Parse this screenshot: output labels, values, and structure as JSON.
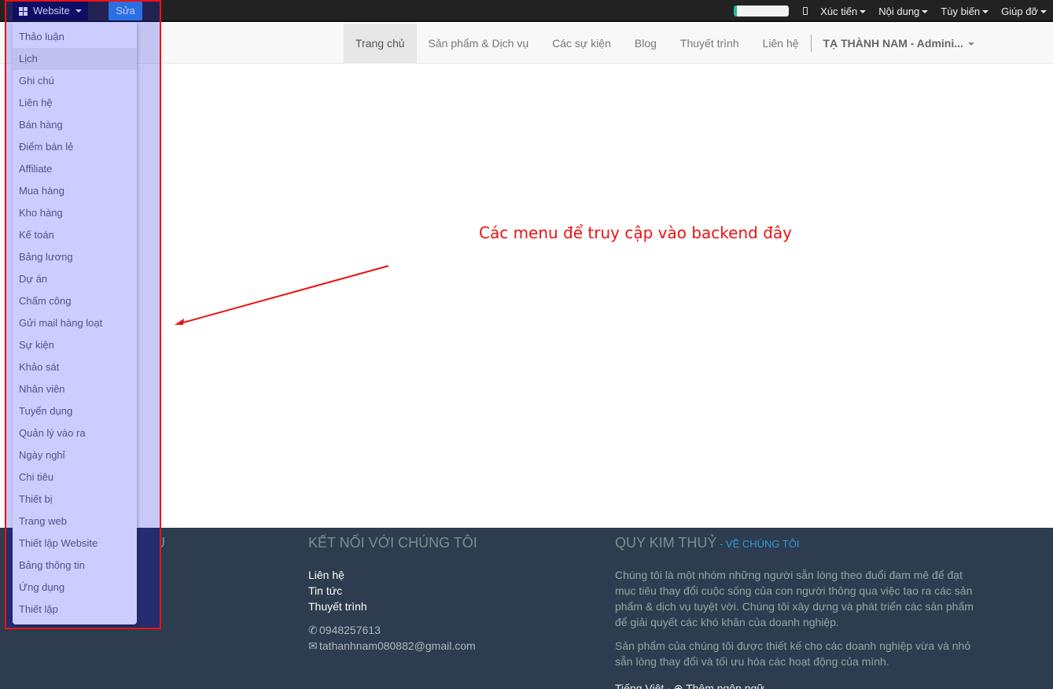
{
  "topbar": {
    "website_label": "Website",
    "edit_label": "Sửa",
    "progress_percent": 5,
    "menus": [
      "Xúc tiến",
      "Nội dung",
      "Tùy biến",
      "Giúp đỡ"
    ]
  },
  "nav": {
    "items": [
      "Trang chủ",
      "Sản phẩm & Dịch vụ",
      "Các sự kiện",
      "Blog",
      "Thuyết trình",
      "Liên hệ"
    ],
    "active_index": 0,
    "user": "TẠ THÀNH NAM - Admini..."
  },
  "dropdown": {
    "hover_index": 1,
    "items": [
      "Thảo luận",
      "Lịch",
      "Ghi chú",
      "Liên hệ",
      "Bán hàng",
      "Điểm bán lẻ",
      "Affiliate",
      "Mua hàng",
      "Kho hàng",
      "Kế toán",
      "Bảng lương",
      "Dự án",
      "Chấm công",
      "Gửi mail hàng loạt",
      "Sự kiện",
      "Khảo sát",
      "Nhân viên",
      "Tuyển dụng",
      "Quản lý vào ra",
      "Ngày nghỉ",
      "Chi tiêu",
      "Thiết bị",
      "Trang web",
      "Thiết lập Website",
      "Bảng thông tin",
      "Ứng dụng",
      "Thiết lập"
    ]
  },
  "annotation": {
    "text": "Các menu để truy cập vào backend đây",
    "color": "#ee1111"
  },
  "footer": {
    "col1_heading": "SẢN PHẨM & DỊCH VỤ",
    "col2_heading": "KẾT NỐI VỚI CHÚNG TÔI",
    "col2_links": [
      "Liên hệ",
      "Tin tức",
      "Thuyết trình"
    ],
    "phone": "0948257613",
    "email": "tathanhnam080882@gmail.com",
    "col3_heading": "QUY KIM THUỶ",
    "col3_sub": "VỀ CHÚNG TÔI",
    "para1": "Chúng tôi là một nhóm những người sẵn lòng theo đuổi đam mê để đạt mục tiêu thay đổi cuộc sống của con người thông qua việc tạo ra các sản phẩm & dịch vụ tuyệt vời. Chúng tôi xây dựng và phát triển các sản phẩm để giải quyết các khó khăn của doanh nghiệp.",
    "para2": "Sản phẩm của chúng tôi được thiết kế cho các doanh nghiệp vừa và nhỏ sẵn lòng thay đổi và tối ưu hóa các hoạt động của mình.",
    "language": "Tiếng Việt",
    "add_language": "Thêm ngôn ngữ"
  },
  "colors": {
    "topbar": "#222222",
    "edit_button": "#2b87e3",
    "dropdown_bg": "#ccccff",
    "footer_bg": "#2d3c4e",
    "link_blue": "#3498db",
    "progress": "#21b799"
  }
}
